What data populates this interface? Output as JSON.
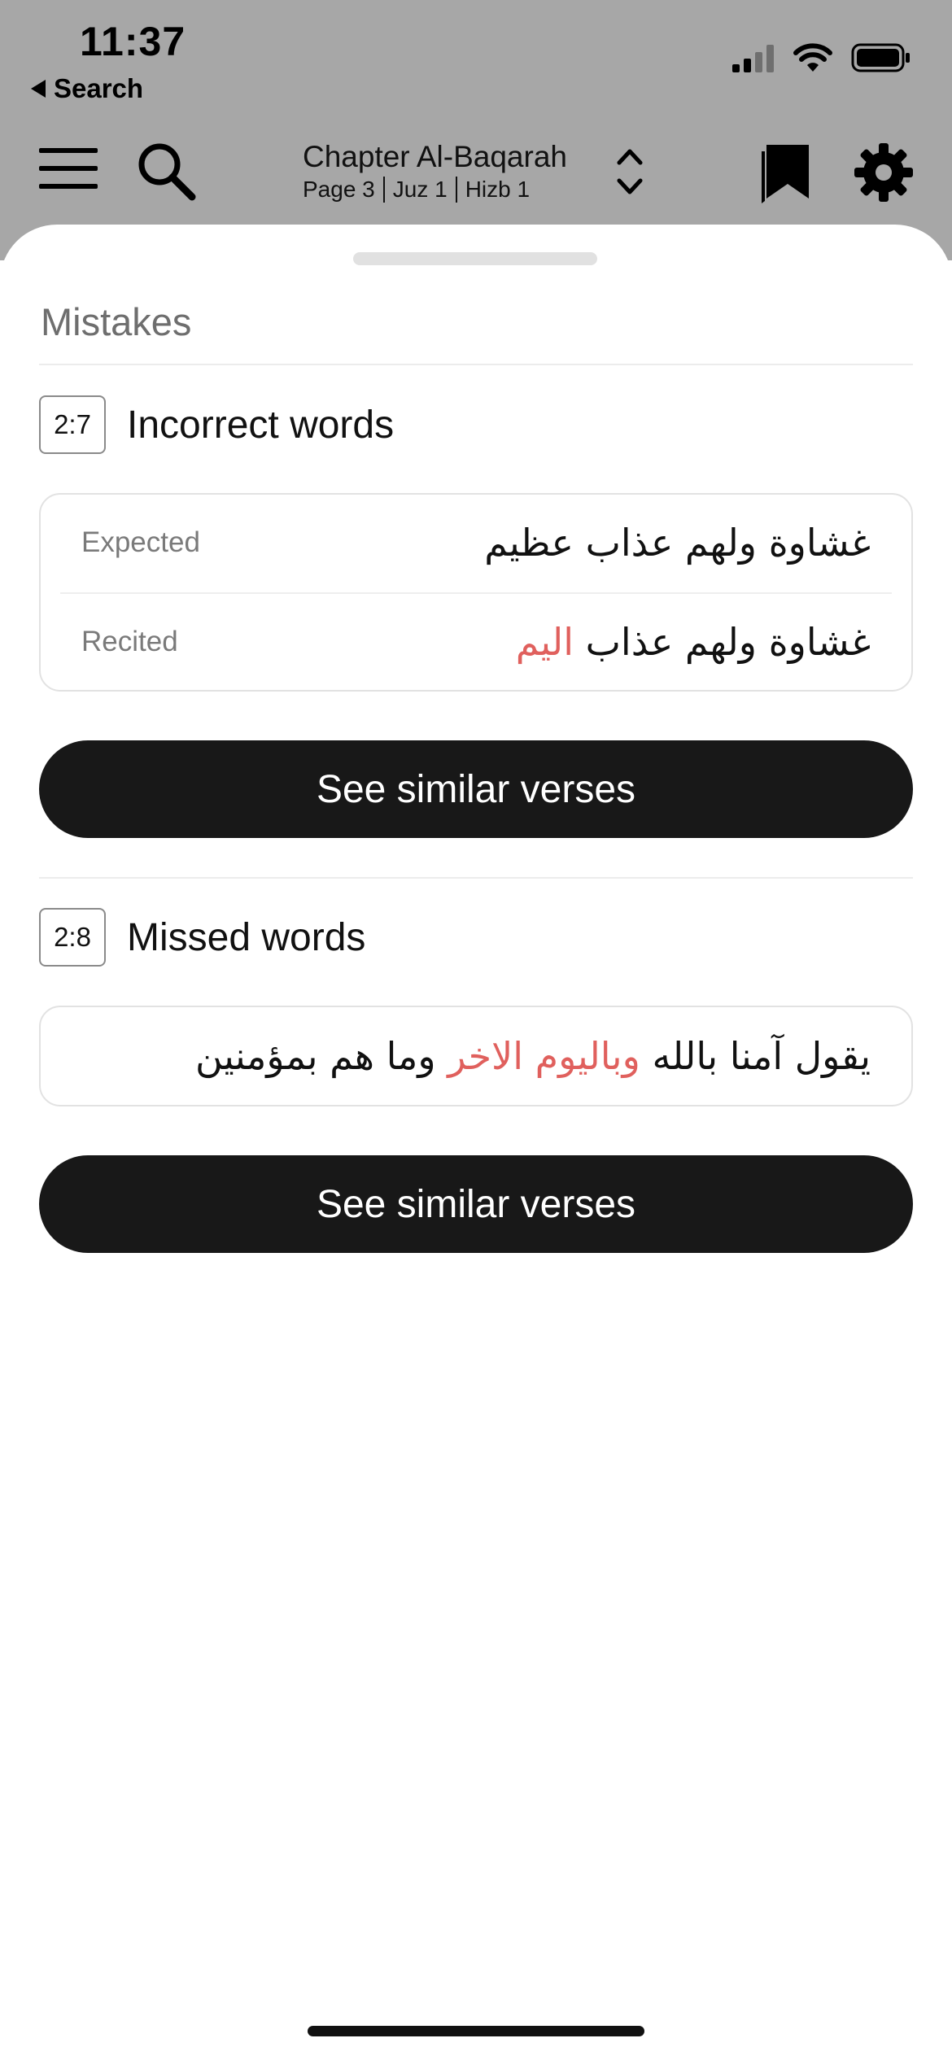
{
  "status_bar": {
    "time": "11:37",
    "back_label": "Search"
  },
  "toolbar": {
    "chapter_title": "Chapter Al-Baqarah",
    "page_label": "Page 3",
    "juz_label": "Juz 1",
    "hizb_label": "Hizb 1"
  },
  "sheet": {
    "title": "Mistakes",
    "incorrect": {
      "ref": "2:7",
      "title": "Incorrect words",
      "expected_label": "Expected",
      "expected_text": "غشاوة ولهم عذاب عظيم",
      "recited_label": "Recited",
      "recited_prefix": "غشاوة ولهم عذاب",
      "recited_error": "اليم",
      "button_label": "See similar verses"
    },
    "missed": {
      "ref": "2:8",
      "title": "Missed words",
      "text_before": "يقول آمنا بالله",
      "text_missing": "وباليوم الاخر",
      "text_after": "وما هم بمؤمنين",
      "button_label": "See similar verses"
    }
  },
  "colors": {
    "error_red": "#e0605d",
    "button_bg": "#181818",
    "dim_background": "#a7a7a7"
  }
}
